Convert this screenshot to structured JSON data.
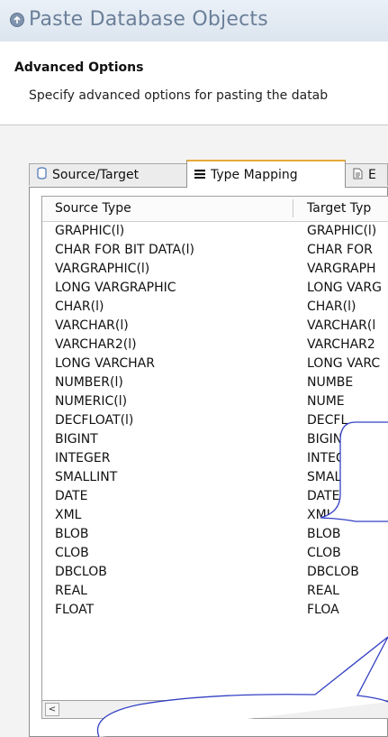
{
  "window": {
    "title": "Paste Database Objects",
    "icon": "database-paste-icon"
  },
  "page": {
    "heading": "Advanced Options",
    "description": "Specify advanced options for pasting the datab"
  },
  "tabs": [
    {
      "label": "Source/Target",
      "icon": "cylinder-icon"
    },
    {
      "label": "Type Mapping",
      "icon": "list-icon"
    },
    {
      "label": "E",
      "icon": "document-icon"
    }
  ],
  "table": {
    "columns": [
      "Source Type",
      "Target Typ"
    ],
    "rows": [
      {
        "source": "GRAPHIC(l)",
        "target": "GRAPHIC(l)"
      },
      {
        "source": "CHAR FOR BIT DATA(l)",
        "target": "CHAR FOR"
      },
      {
        "source": "VARGRAPHIC(l)",
        "target": "VARGRAPH"
      },
      {
        "source": "LONG VARGRAPHIC",
        "target": "LONG VARG"
      },
      {
        "source": "CHAR(l)",
        "target": "CHAR(l)"
      },
      {
        "source": "VARCHAR(l)",
        "target": "VARCHAR(l"
      },
      {
        "source": "VARCHAR2(l)",
        "target": "VARCHAR2"
      },
      {
        "source": "LONG VARCHAR",
        "target": "LONG VARC"
      },
      {
        "source": "NUMBER(l)",
        "target": "NUMBE"
      },
      {
        "source": "NUMERIC(l)",
        "target": "NUME"
      },
      {
        "source": "DECFLOAT(l)",
        "target": "DECFL"
      },
      {
        "source": "BIGINT",
        "target": "BIGIN"
      },
      {
        "source": "INTEGER",
        "target": "INTEG"
      },
      {
        "source": "SMALLINT",
        "target": "SMALLINT"
      },
      {
        "source": "DATE",
        "target": "DATE"
      },
      {
        "source": "XML",
        "target": "XML"
      },
      {
        "source": "BLOB",
        "target": "BLOB"
      },
      {
        "source": "CLOB",
        "target": "CLOB"
      },
      {
        "source": "DBCLOB",
        "target": "DBCLOB"
      },
      {
        "source": "REAL",
        "target": "REAL"
      },
      {
        "source": "FLOAT",
        "target": "FLOA"
      }
    ]
  },
  "scrollbar": {
    "left_arrow": "<"
  },
  "colors": {
    "title_text": "#6b7f99",
    "active_tab_accent": "#e6a93a",
    "callout_stroke": "#3340c4"
  }
}
